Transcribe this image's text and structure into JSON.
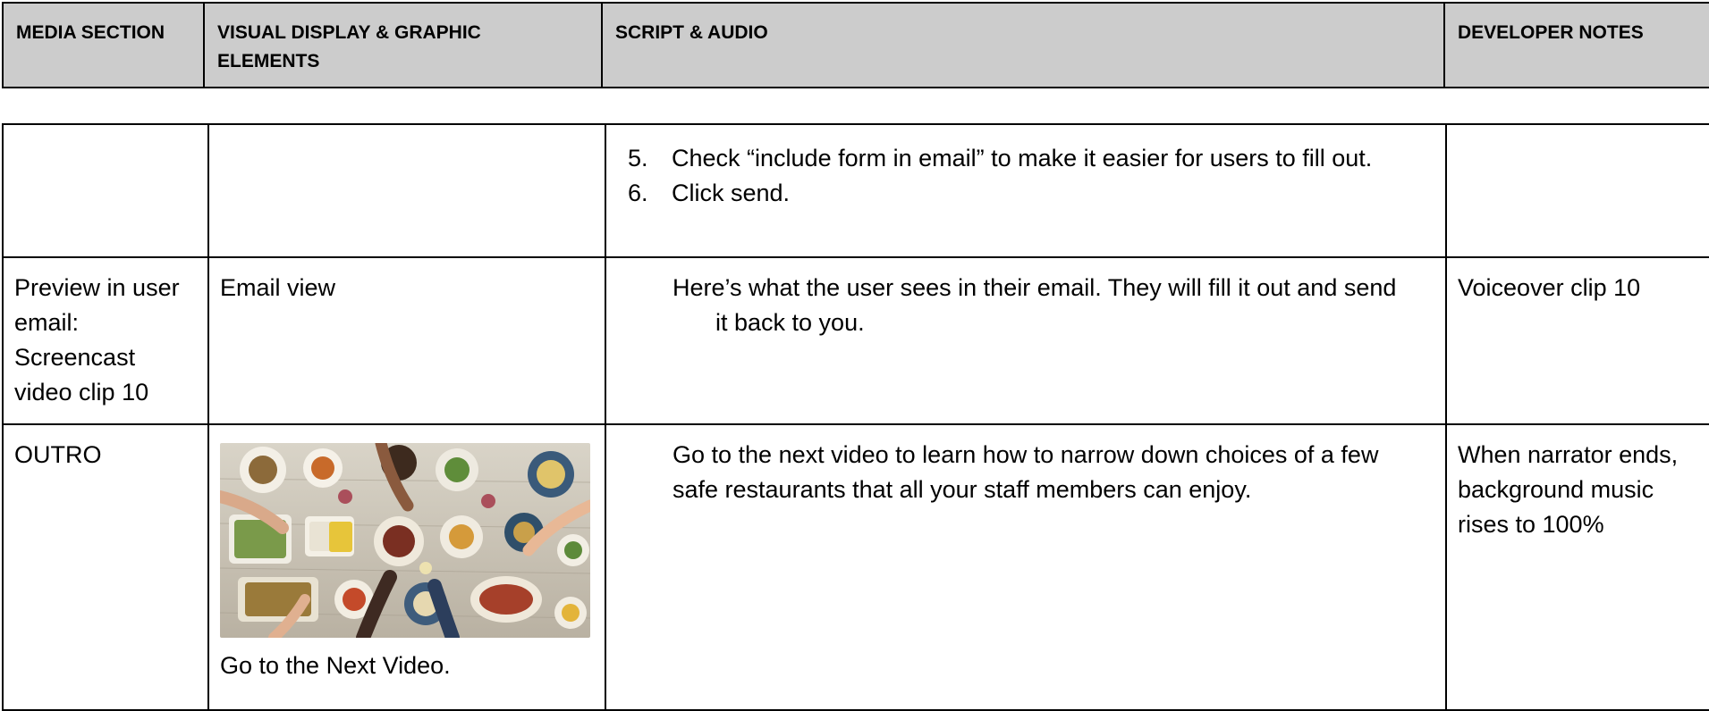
{
  "header": {
    "col1": "MEDIA SECTION",
    "col2": "VISUAL DISPLAY & GRAPHIC ELEMENTS",
    "col3": "SCRIPT & AUDIO",
    "col4": "DEVELOPER NOTES"
  },
  "rows": [
    {
      "media": "",
      "visual": "",
      "steps": [
        {
          "num": "5.",
          "text": "Check “include form in email” to make it easier for users to fill out."
        },
        {
          "num": "6.",
          "text": "Click send."
        }
      ],
      "notes": ""
    },
    {
      "media": "Preview in user email: Screencast video clip 10",
      "visual": "Email view",
      "script": "Here’s what the user sees in their email. They will fill it out and send it back to you.",
      "notes": "Voiceover clip 10"
    },
    {
      "media": "OUTRO",
      "visual_caption": "Go to the Next Video.",
      "image_icon": "food-table-photo",
      "script": "Go to the next video to learn how to narrow down choices of a few safe restaurants that all your staff members can enjoy.",
      "notes": "When narrator ends, background music rises to 100%"
    }
  ],
  "colors": {
    "header_bg": "#cccccc",
    "border": "#000000"
  }
}
